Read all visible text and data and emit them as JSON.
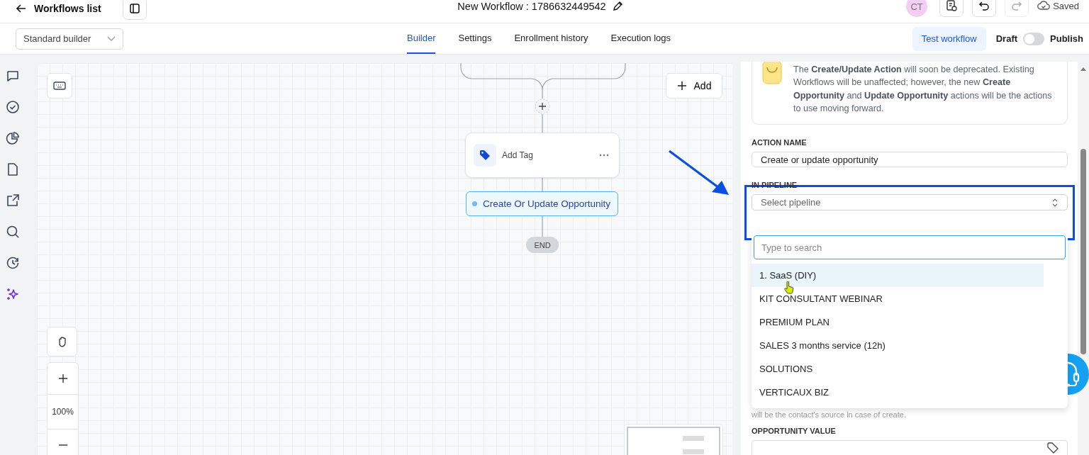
{
  "header": {
    "back_label": "Workflows list",
    "title": "New Workflow : 1786632449542",
    "avatar": "CT",
    "save_status": "Saved"
  },
  "toolbar": {
    "builder_select": "Standard builder",
    "tabs": [
      {
        "label": "Builder",
        "selected": true
      },
      {
        "label": "Settings",
        "selected": false
      },
      {
        "label": "Enrollment history",
        "selected": false
      },
      {
        "label": "Execution logs",
        "selected": false
      }
    ],
    "test_button": "Test workflow",
    "toggle": {
      "off_label": "Draft",
      "on_label": "Publish",
      "on": false
    }
  },
  "canvas": {
    "add_button": "Add",
    "nodes": [
      {
        "kind": "card",
        "label": "Add Tag",
        "selected": false
      },
      {
        "kind": "pill",
        "label": "Create Or Update Opportunity",
        "selected": true
      }
    ],
    "end_label": "END",
    "zoom_level": "100%"
  },
  "panel": {
    "notice": "The **Create/Update Action** will soon be deprecated. Existing Workflows will be unaffected; however, the new **Create Opportunity** and **Update Opportunity** actions will be the actions to use moving forward.",
    "action_name": {
      "label": "ACTION NAME",
      "value": "Create or update opportunity"
    },
    "pipeline": {
      "label": "IN PIPELINE",
      "placeholder": "Select pipeline",
      "expanded": true
    },
    "dropdown": {
      "search_placeholder": "Type to search",
      "options": [
        {
          "label": "1. SaaS (DIY)",
          "selected": true
        },
        {
          "label": "KIT CONSULTANT WEBINAR",
          "selected": false
        },
        {
          "label": "PREMIUM PLAN",
          "selected": false
        },
        {
          "label": "SALES 3 months service (12h)",
          "selected": false
        },
        {
          "label": "SOLUTIONS",
          "selected": false
        },
        {
          "label": "VERTICAUX BIZ",
          "selected": false
        }
      ]
    },
    "hint": "will be the contact's source in case of create.",
    "opportunity_value": {
      "label": "OPPORTUNITY VALUE"
    }
  }
}
